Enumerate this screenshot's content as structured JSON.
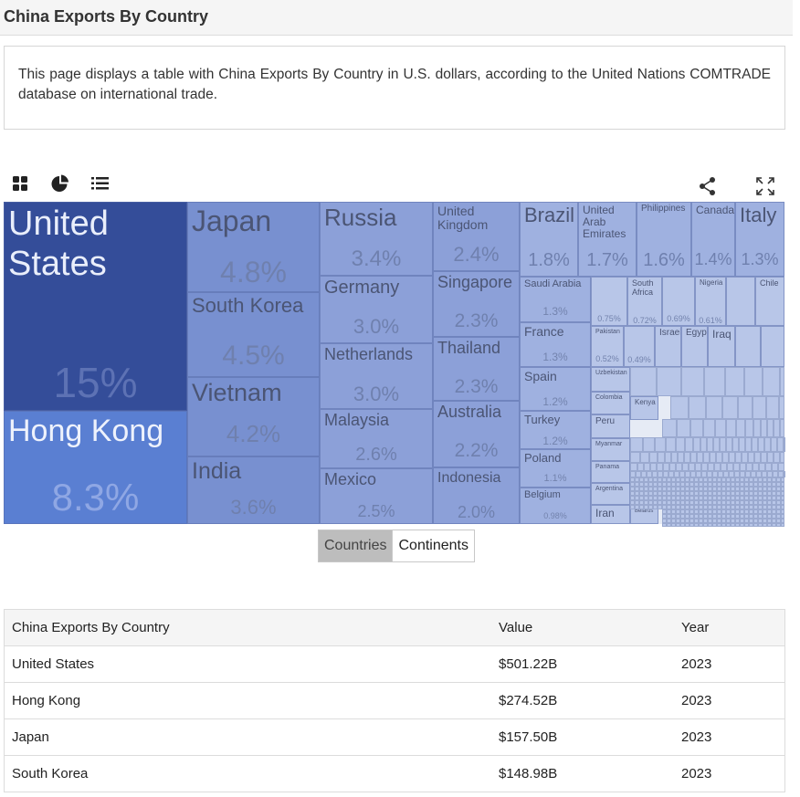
{
  "page": {
    "title": "China Exports By Country",
    "description": "This page displays a table with China Exports By Country in U.S. dollars, according to the United Nations COMTRADE database on international trade."
  },
  "toolbar": {
    "icons": [
      "grid-icon",
      "pie-chart-icon",
      "list-icon",
      "share-icon",
      "expand-icon"
    ]
  },
  "chart_data": {
    "type": "treemap",
    "colors": {
      "top": "#344d99",
      "second": "#5a7fd2",
      "large": "#7890d0",
      "medium": "#8ca0d8",
      "small": "#9fb1e0",
      "tiny": "#b8c6e8"
    },
    "items": [
      {
        "label": "United States",
        "share": "15%"
      },
      {
        "label": "Hong Kong",
        "share": "8.3%"
      },
      {
        "label": "Japan",
        "share": "4.8%"
      },
      {
        "label": "South Korea",
        "share": "4.5%"
      },
      {
        "label": "Vietnam",
        "share": "4.2%"
      },
      {
        "label": "India",
        "share": "3.6%"
      },
      {
        "label": "Russia",
        "share": "3.4%"
      },
      {
        "label": "Germany",
        "share": "3.0%"
      },
      {
        "label": "Netherlands",
        "share": "3.0%"
      },
      {
        "label": "Malaysia",
        "share": "2.6%"
      },
      {
        "label": "Mexico",
        "share": "2.5%"
      },
      {
        "label": "United Kingdom",
        "share": "2.4%"
      },
      {
        "label": "Singapore",
        "share": "2.3%"
      },
      {
        "label": "Thailand",
        "share": "2.3%"
      },
      {
        "label": "Australia",
        "share": "2.2%"
      },
      {
        "label": "Indonesia",
        "share": "2.0%"
      },
      {
        "label": "Brazil",
        "share": "1.8%"
      },
      {
        "label": "United Arab Emirates",
        "share": "1.7%"
      },
      {
        "label": "Philippines",
        "share": "1.6%"
      },
      {
        "label": "Canada",
        "share": "1.4%"
      },
      {
        "label": "Italy",
        "share": "1.3%"
      },
      {
        "label": "Saudi Arabia",
        "share": "1.3%"
      },
      {
        "label": "France",
        "share": "1.3%"
      },
      {
        "label": "Spain",
        "share": "1.2%"
      },
      {
        "label": "Turkey",
        "share": "1.2%"
      },
      {
        "label": "Poland",
        "share": "1.1%"
      },
      {
        "label": "Belgium",
        "share": "0.98%"
      },
      {
        "label": "South Africa",
        "share": "0.72%"
      },
      {
        "label": "Nigeria",
        "share": "0.61%"
      },
      {
        "label": "Chile",
        "share": ""
      },
      {
        "label": "Pakistan",
        "share": "0.52%"
      },
      {
        "label": "Israel",
        "share": ""
      },
      {
        "label": "Egypt",
        "share": ""
      },
      {
        "label": "Iraq",
        "share": ""
      },
      {
        "label": "Uzbekistan",
        "share": ""
      },
      {
        "label": "Colombia",
        "share": ""
      },
      {
        "label": "Kenya",
        "share": ""
      },
      {
        "label": "Peru",
        "share": ""
      },
      {
        "label": "Myanmar",
        "share": ""
      },
      {
        "label": "Panama",
        "share": ""
      },
      {
        "label": "Argentina",
        "share": ""
      },
      {
        "label": "Iran",
        "share": ""
      },
      {
        "label": "Belarus",
        "share": ""
      }
    ],
    "unlabeled_shares": [
      "0.75%",
      "0.69%",
      "0.49%"
    ]
  },
  "toggle": {
    "countries": "Countries",
    "continents": "Continents"
  },
  "table": {
    "headers": [
      "China Exports By Country",
      "Value",
      "Year"
    ],
    "rows": [
      [
        "United States",
        "$501.22B",
        "2023"
      ],
      [
        "Hong Kong",
        "$274.52B",
        "2023"
      ],
      [
        "Japan",
        "$157.50B",
        "2023"
      ],
      [
        "South Korea",
        "$148.98B",
        "2023"
      ]
    ]
  }
}
